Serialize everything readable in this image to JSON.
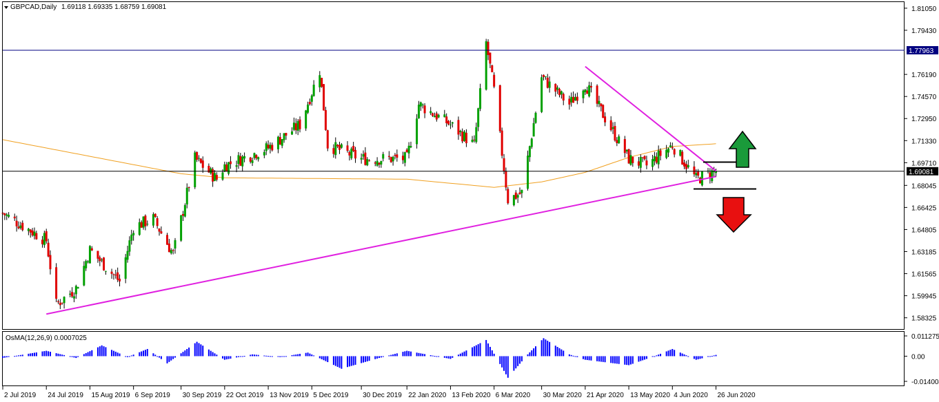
{
  "header": {
    "symbol_label": "GBPCAD,Daily",
    "ohlc_label": "1.69118 1.69335 1.68759 1.69081"
  },
  "indicator": {
    "label": "OsMA(12,26,9) 0.0007025",
    "axis_ticks": [
      "0.0112755",
      "0.00",
      "-0.0140049"
    ]
  },
  "colors": {
    "bull": "#00a000",
    "bear": "#e00000",
    "wick": "#000000",
    "ma": "#f0a020",
    "trendline": "#e020e0",
    "level_line": "#000080",
    "current_line": "#000000",
    "osma_bars": "#0000ff",
    "up_arrow": "#1a9a3a",
    "down_arrow": "#e81010"
  },
  "chart_data": [
    {
      "type": "candlestick",
      "title": "GBPCAD,Daily",
      "ylim": [
        1.575,
        1.815
      ],
      "y_ticks": [
        "1.81050",
        "1.79430",
        "1.77963",
        "1.76190",
        "1.74570",
        "1.72950",
        "1.71330",
        "1.69710",
        "1.69081",
        "1.68045",
        "1.66425",
        "1.64805",
        "1.63185",
        "1.61565",
        "1.59945",
        "1.58325"
      ],
      "x_ticks": [
        "2 Jul 2019",
        "24 Jul 2019",
        "15 Aug 2019",
        "6 Sep 2019",
        "30 Sep 2019",
        "22 Oct 2019",
        "13 Nov 2019",
        "5 Dec 2019",
        "30 Dec 2019",
        "22 Jan 2020",
        "13 Feb 2020",
        "6 Mar 2020",
        "30 Mar 2020",
        "21 Apr 2020",
        "13 May 2020",
        "4 Jun 2020",
        "26 Jun 2020"
      ],
      "horizontal_levels": [
        {
          "value": 1.77963,
          "label": "1.77963"
        },
        {
          "value": 1.69081,
          "label": "1.69081"
        }
      ],
      "moving_average": [
        [
          "2 Jul 2019",
          1.714
        ],
        [
          "30 Sep 2019",
          1.689
        ],
        [
          "22 Oct 2019",
          1.686
        ],
        [
          "22 Jan 2020",
          1.685
        ],
        [
          "6 Mar 2020",
          1.679
        ],
        [
          "30 Mar 2020",
          1.683
        ],
        [
          "21 Apr 2020",
          1.69
        ],
        [
          "13 May 2020",
          1.701
        ],
        [
          "4 Jun 2020",
          1.709
        ],
        [
          "26 Jun 2020",
          1.711
        ]
      ],
      "trendlines": [
        {
          "name": "support",
          "from": [
            "24 Jul 2019",
            1.586
          ],
          "to": [
            "26 Jun 2020",
            1.687
          ]
        },
        {
          "name": "resistance",
          "from": [
            "21 Apr 2020",
            1.7677
          ],
          "to": [
            "26 Jun 2020",
            1.691
          ]
        }
      ],
      "range_box": {
        "upper": 1.6975,
        "lower": 1.6778
      },
      "series": [
        {
          "name": "GBPCAD",
          "waypoints": [
            [
              "2 Jul 2019",
              1.66
            ],
            [
              "24 Jul 2019",
              1.64
            ],
            [
              "29 Jul 2019",
              1.593
            ],
            [
              "8 Aug 2019",
              1.605
            ],
            [
              "15 Aug 2019",
              1.633
            ],
            [
              "30 Aug 2019",
              1.61
            ],
            [
              "6 Sep 2019",
              1.65
            ],
            [
              "16 Sep 2019",
              1.656
            ],
            [
              "26 Sep 2019",
              1.63
            ],
            [
              "7 Oct 2019",
              1.7
            ],
            [
              "18 Oct 2019",
              1.685
            ],
            [
              "22 Oct 2019",
              1.695
            ],
            [
              "13 Nov 2019",
              1.708
            ],
            [
              "29 Nov 2019",
              1.725
            ],
            [
              "9 Dec 2019",
              1.765
            ],
            [
              "13 Dec 2019",
              1.71
            ],
            [
              "30 Dec 2019",
              1.7
            ],
            [
              "22 Jan 2020",
              1.7
            ],
            [
              "28 Jan 2020",
              1.74
            ],
            [
              "13 Feb 2020",
              1.725
            ],
            [
              "25 Feb 2020",
              1.71
            ],
            [
              "2 Mar 2020",
              1.785
            ],
            [
              "6 Mar 2020",
              1.75
            ],
            [
              "13 Mar 2020",
              1.67
            ],
            [
              "20 Mar 2020",
              1.675
            ],
            [
              "30 Mar 2020",
              1.76
            ],
            [
              "13 Apr 2020",
              1.74
            ],
            [
              "21 Apr 2020",
              1.755
            ],
            [
              "13 May 2020",
              1.7
            ],
            [
              "22 May 2020",
              1.695
            ],
            [
              "4 Jun 2020",
              1.71
            ],
            [
              "16 Jun 2020",
              1.685
            ],
            [
              "26 Jun 2020",
              1.691
            ]
          ]
        }
      ]
    },
    {
      "type": "bar",
      "title": "OsMA(12,26,9) 0.0007025",
      "ylim": [
        -0.0140049,
        0.0112755
      ],
      "series": [
        {
          "name": "OsMA",
          "waypoints": [
            [
              "2 Jul 2019",
              -0.001
            ],
            [
              "24 Jul 2019",
              0.003
            ],
            [
              "8 Aug 2019",
              -0.001
            ],
            [
              "21 Aug 2019",
              0.006
            ],
            [
              "3 Sep 2019",
              -0.0005
            ],
            [
              "13 Sep 2019",
              0.004
            ],
            [
              "23 Sep 2019",
              -0.004
            ],
            [
              "8 Oct 2019",
              0.008
            ],
            [
              "22 Oct 2019",
              -0.002
            ],
            [
              "5 Nov 2019",
              0.001
            ],
            [
              "19 Nov 2019",
              -0.0005
            ],
            [
              "3 Dec 2019",
              0.002
            ],
            [
              "20 Dec 2019",
              -0.007
            ],
            [
              "8 Jan 2020",
              -0.001
            ],
            [
              "22 Jan 2020",
              0.003
            ],
            [
              "13 Feb 2020",
              -0.0015
            ],
            [
              "2 Mar 2020",
              0.009
            ],
            [
              "13 Mar 2020",
              -0.012
            ],
            [
              "23 Mar 2020",
              0.001
            ],
            [
              "31 Mar 2020",
              0.01
            ],
            [
              "13 Apr 2020",
              0.001
            ],
            [
              "21 Apr 2020",
              -0.002
            ],
            [
              "13 May 2020",
              -0.005
            ],
            [
              "26 May 2020",
              0.0
            ],
            [
              "4 Jun 2020",
              0.004
            ],
            [
              "16 Jun 2020",
              -0.002
            ],
            [
              "26 Jun 2020",
              0.0007
            ]
          ]
        }
      ]
    }
  ]
}
